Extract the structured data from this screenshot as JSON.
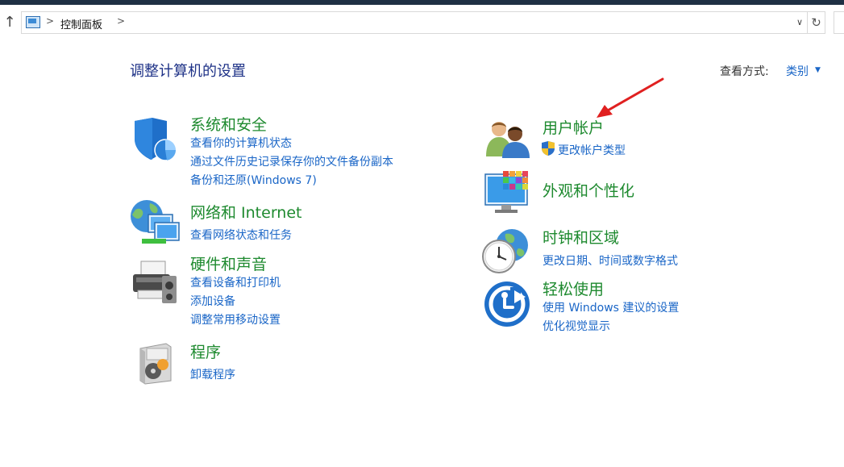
{
  "address_bar": {
    "breadcrumb": "控制面板",
    "sep1": ">",
    "sep2": ">",
    "up_glyph": "↑",
    "dropdown_glyph": "∨",
    "refresh_glyph": "↻"
  },
  "header": {
    "title": "调整计算机的设置",
    "view_by_label": "查看方式:",
    "view_by_value": "类别"
  },
  "categories": {
    "system_security": {
      "title": "系统和安全",
      "links": [
        "查看你的计算机状态",
        "通过文件历史记录保存你的文件备份副本",
        "备份和还原(Windows 7)"
      ]
    },
    "network": {
      "title": "网络和 Internet",
      "links": [
        "查看网络状态和任务"
      ]
    },
    "hardware": {
      "title": "硬件和声音",
      "links": [
        "查看设备和打印机",
        "添加设备",
        "调整常用移动设置"
      ]
    },
    "programs": {
      "title": "程序",
      "links": [
        "卸载程序"
      ]
    },
    "user_accounts": {
      "title": "用户帐户",
      "links": [
        "更改帐户类型"
      ]
    },
    "appearance": {
      "title": "外观和个性化",
      "links": []
    },
    "clock_region": {
      "title": "时钟和区域",
      "links": [
        "更改日期、时间或数字格式"
      ]
    },
    "ease_of_access": {
      "title": "轻松使用",
      "links": [
        "使用 Windows 建议的设置",
        "优化视觉显示"
      ]
    }
  },
  "colors": {
    "title_blue": "#1e3287",
    "category_green": "#1e8a2f",
    "link_blue": "#1a66c7",
    "annotation_red": "#e02020"
  },
  "icons": [
    "shield-icon",
    "network-icon",
    "printer-icon",
    "programs-icon",
    "users-icon",
    "uac-shield-icon",
    "appearance-icon",
    "clock-globe-icon",
    "ease-of-access-icon"
  ]
}
